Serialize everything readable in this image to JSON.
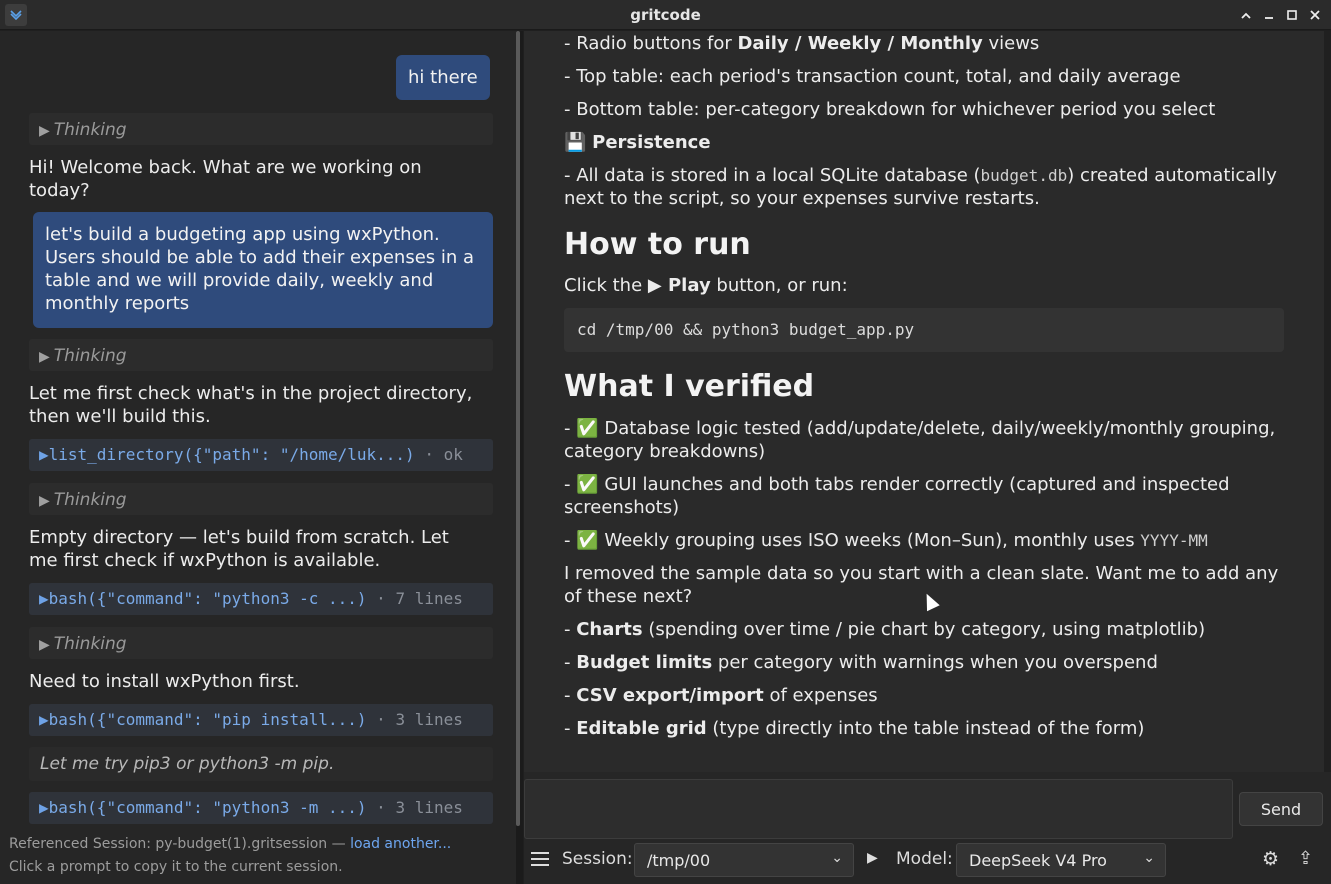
{
  "window": {
    "title": "gritcode"
  },
  "left": {
    "user_msg_1": "hi there",
    "thinking_label": "Thinking",
    "assistant_1": "Hi! Welcome back. What are we working on today?",
    "user_msg_2": "let's build a budgeting app using wxPython. Users should be able to add their expenses in a table and we will provide daily, weekly and monthly reports",
    "assistant_2": "Let me first check what's in the project directory, then we'll build this.",
    "tool_1": {
      "call": "list_directory({\"path\": \"/home/luk...)",
      "meta": "· ok"
    },
    "assistant_3": "Empty directory — let's build from scratch. Let me first check if wxPython is available.",
    "tool_2": {
      "call": "bash({\"command\": \"python3 -c ...)",
      "meta": "· 7 lines"
    },
    "assistant_4": "Need to install wxPython first.",
    "tool_3": {
      "call": "bash({\"command\": \"pip install...)",
      "meta": "· 3 lines"
    },
    "note": "Let me try pip3 or python3 -m pip.",
    "tool_4": {
      "call": "bash({\"command\": \"python3 -m ...)",
      "meta": "· 3 lines"
    },
    "ref_session": "Referenced Session: py-budget(1).gritsession —",
    "ref_link": "load another...",
    "ref_hint": "Click a prompt to copy it to the current session."
  },
  "right": {
    "l1_pre": "- Radio buttons for ",
    "l1_b": "Daily / Weekly / Monthly",
    "l1_post": " views",
    "l2": "- Top table: each period's transaction count, total, and daily average",
    "l3": "- Bottom table: per-category breakdown for whichever period you select",
    "persist_icon": "💾",
    "persist_title": "Persistence",
    "l4_pre": "- All data is stored in a local SQLite database (",
    "l4_code": "budget.db",
    "l4_post": ") created automatically next to the script, so your expenses survive restarts.",
    "h_run": "How to run",
    "run_pre": "Click the ",
    "run_b": "▶ Play",
    "run_post": " button, or run:",
    "code": "cd /tmp/00 && python3 budget_app.py",
    "h_verified": "What I verified",
    "v1": "- ✅ Database logic tested (add/update/delete, daily/weekly/monthly grouping, category breakdowns)",
    "v2": "- ✅ GUI launches and both tabs render correctly (captured and inspected screenshots)",
    "v3_pre": "- ✅ Weekly grouping uses ISO weeks (Mon–Sun), monthly uses ",
    "v3_code": "YYYY-MM",
    "removed": "I removed the sample data so you start with a clean slate. Want me to add any of these next?",
    "n1_b": "Charts",
    "n1": " (spending over time / pie chart by category, using matplotlib)",
    "n2_b": "Budget limits",
    "n2": " per category with warnings when you overspend",
    "n3_b": "CSV export/import",
    "n3": " of expenses",
    "n4_b": "Editable grid",
    "n4": " (type directly into the table instead of the form)",
    "dash": "- "
  },
  "composer": {
    "send": "Send",
    "session_label": "Session:",
    "session_value": "/tmp/00",
    "model_label": "Model:",
    "model_value": "DeepSeek V4 Pro"
  }
}
